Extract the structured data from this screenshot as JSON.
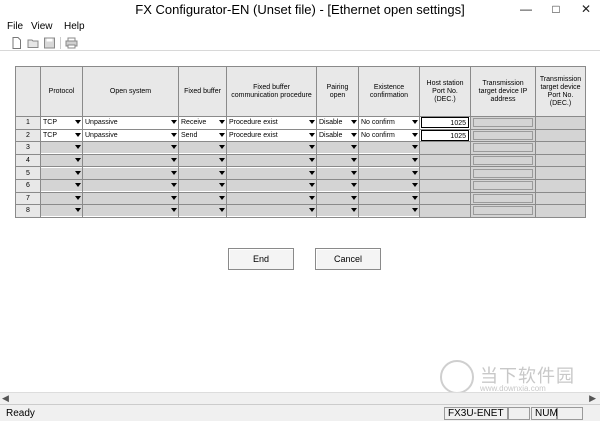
{
  "window": {
    "title": "FX Configurator-EN (Unset file) - [Ethernet open settings]"
  },
  "menu": {
    "items": [
      "File",
      "View",
      "Help"
    ]
  },
  "toolbar": {
    "icons": [
      "new-file-icon",
      "open-folder-icon",
      "save-icon",
      "print-icon"
    ]
  },
  "table": {
    "headers": {
      "protocol": "Protocol",
      "open_system": "Open system",
      "fixed_buffer": "Fixed buffer",
      "fb_comm": "Fixed buffer communication procedure",
      "pairing": "Pairing open",
      "existence": "Existence confirmation",
      "host_port": "Host station Port No. (DEC.)",
      "target_ip": "Transmission target device IP address",
      "target_port": "Transmission target device Port No. (DEC.)"
    },
    "rows": [
      {
        "num": "1",
        "protocol": "TCP",
        "open_system": "Unpassive",
        "fixed_buffer": "Receive",
        "fb_comm": "Procedure exist",
        "pairing": "Disable",
        "existence": "No confirm",
        "host_port": "1025"
      },
      {
        "num": "2",
        "protocol": "TCP",
        "open_system": "Unpassive",
        "fixed_buffer": "Send",
        "fb_comm": "Procedure exist",
        "pairing": "Disable",
        "existence": "No confirm",
        "host_port": "1025"
      },
      {
        "num": "3"
      },
      {
        "num": "4"
      },
      {
        "num": "5"
      },
      {
        "num": "6"
      },
      {
        "num": "7"
      },
      {
        "num": "8"
      }
    ]
  },
  "buttons": {
    "end": "End",
    "cancel": "Cancel"
  },
  "status": {
    "ready": "Ready",
    "model": "FX3U-ENET",
    "num": "NUM"
  },
  "watermark": {
    "text": "当下软件园",
    "url": "www.downxia.com"
  }
}
